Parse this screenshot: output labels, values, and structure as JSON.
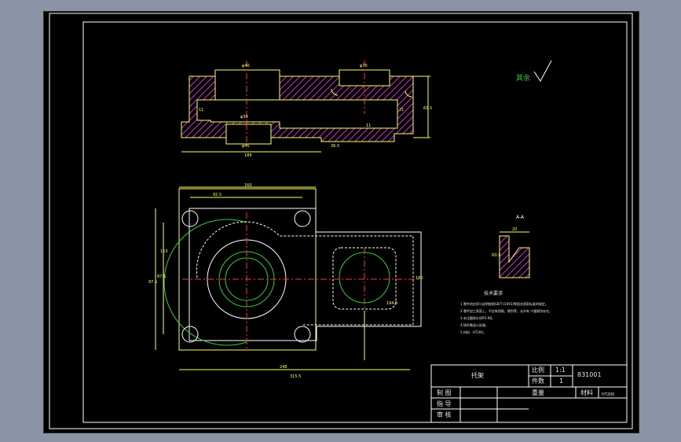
{
  "drawing": {
    "top_view_dims": [
      "φ40",
      "φ70",
      "φ30",
      "φ45",
      "188",
      "11",
      "21",
      "61.5",
      "36.5",
      "11"
    ],
    "plan_view_dims": [
      "160",
      "92.5",
      "153",
      "97.5",
      "87.5",
      "180",
      "248",
      "315.5",
      "194.5"
    ],
    "surface_mark": "其余",
    "detail_label": "A-A",
    "detail_dims": [
      "20",
      "R0.5"
    ],
    "tech_requirements": {
      "title": "技术要求",
      "lines": [
        "1.零件的应用与说明按照GB/T-(1093)等相关国家标准的规定。",
        "2.零件加工表面上，不应有划痕、擦伤等，允许有 少量损伤存在。",
        "3.未注圆角半径R5-R8。",
        "4.铸件需退火处理。",
        "5.材料：HT200。"
      ]
    },
    "title_block": {
      "part_name": "托架",
      "scale_label": "比例",
      "scale_value": "1:1",
      "qty_label": "件数",
      "qty_value": "1",
      "drawing_no": "831001",
      "drawn_label": "制 图",
      "designed_label": "指 导",
      "checked_label": "审 核",
      "weight_label": "重量",
      "material_label": "材料",
      "material_value": "HT200"
    }
  },
  "colors": {
    "background": "#000000",
    "outline": "#ffff66",
    "hatch": "#cc33cc",
    "center_line": "#ff3333",
    "hidden_line": "#ffffff",
    "green": "#33cc33",
    "text": "#e6e6e6"
  }
}
